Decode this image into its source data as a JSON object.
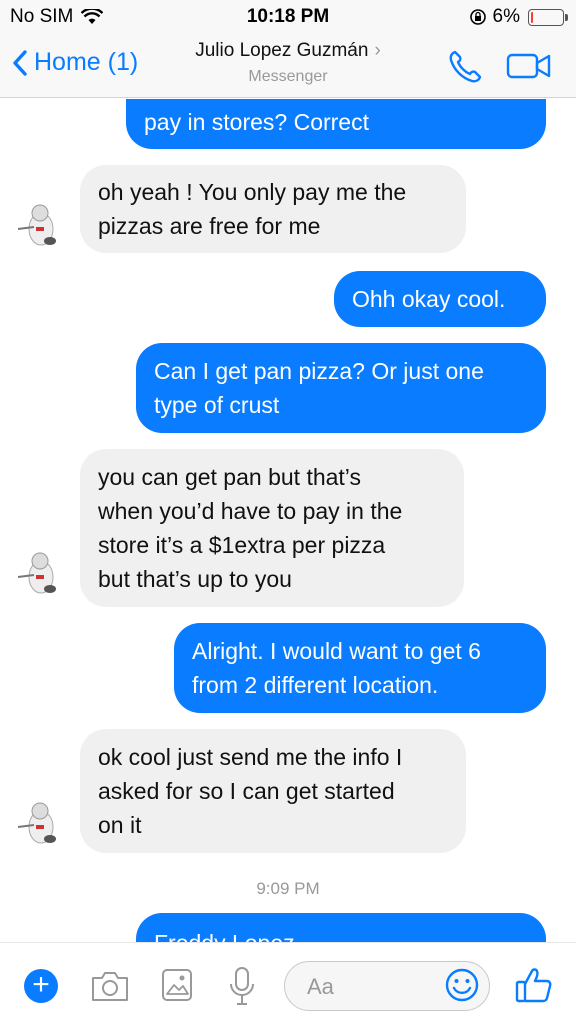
{
  "status_bar": {
    "carrier": "No SIM",
    "time": "10:18 PM",
    "battery_percent": "6%",
    "battery_level": 0.06,
    "battery_color": "#ff3b30"
  },
  "nav": {
    "back_label": "Home (1)",
    "contact_name": "Julio Lopez Guzmán",
    "subtitle": "Messenger",
    "accent_color": "#0a7cff"
  },
  "messages": [
    {
      "dir": "out",
      "lines": [
        "pay in stores? Correct"
      ]
    },
    {
      "dir": "in",
      "lines": [
        "oh yeah ! You only pay me the",
        "pizzas are free for me"
      ]
    },
    {
      "dir": "out",
      "lines": [
        "Ohh okay cool."
      ]
    },
    {
      "dir": "out",
      "lines": [
        "Can I get pan pizza? Or just one",
        "type of crust"
      ]
    },
    {
      "dir": "in",
      "lines": [
        "you can get pan but that’s",
        "when you’d have to pay in the",
        "store it’s a $1extra per pizza",
        "but that’s up to you"
      ]
    },
    {
      "dir": "out",
      "lines": [
        "Alright. I would want to get 6",
        "from 2 different location."
      ]
    },
    {
      "dir": "in",
      "lines": [
        "ok cool just send me the info I",
        "asked for so I can get started",
        "on it"
      ]
    },
    {
      "dir": "out",
      "lines": [
        "Freddy Lopez"
      ]
    }
  ],
  "timestamp": "9:09 PM",
  "composer": {
    "placeholder": "Aa",
    "icons": [
      "plus-icon",
      "camera-icon",
      "gallery-icon",
      "microphone-icon",
      "emoji-icon",
      "thumbs-up-icon"
    ]
  }
}
